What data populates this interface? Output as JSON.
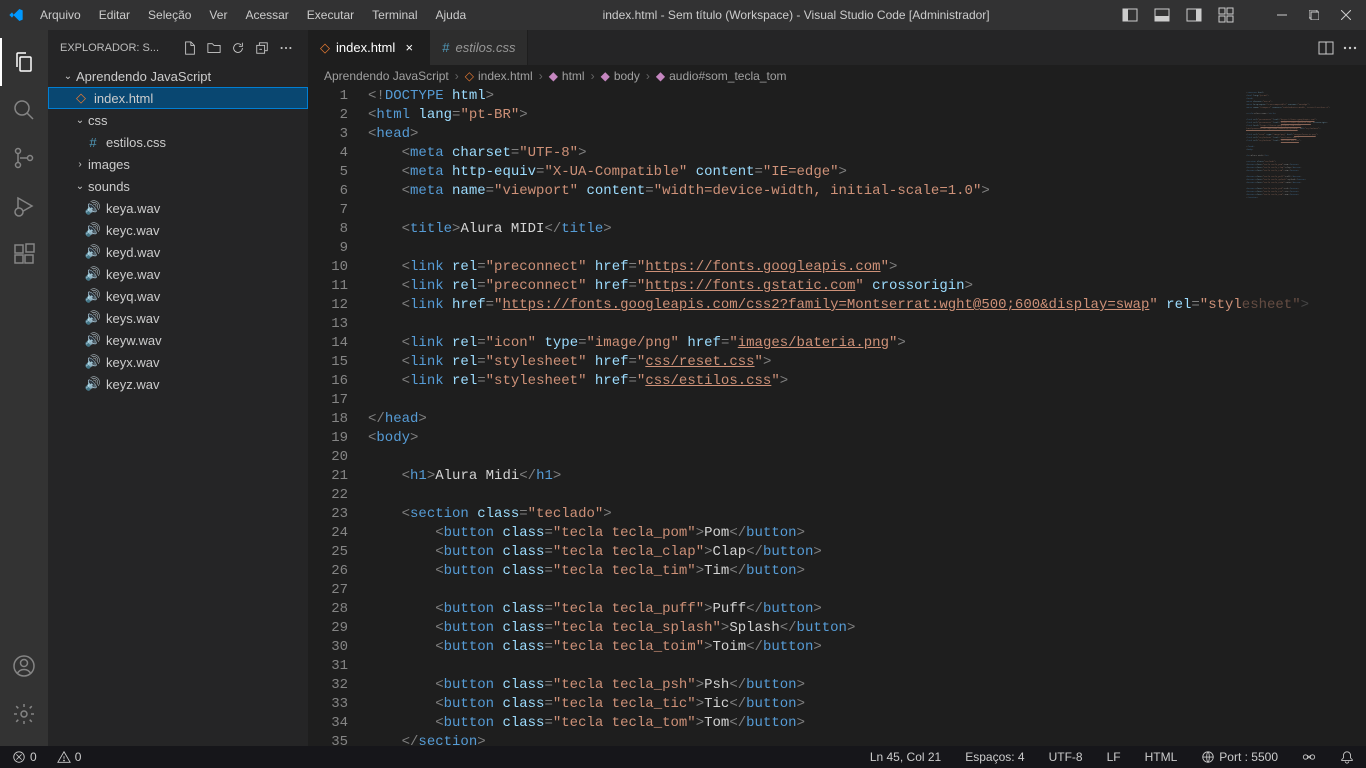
{
  "titlebar": {
    "menus": [
      "Arquivo",
      "Editar",
      "Seleção",
      "Ver",
      "Acessar",
      "Executar",
      "Terminal",
      "Ajuda"
    ],
    "title": "index.html - Sem título (Workspace) - Visual Studio Code [Administrador]"
  },
  "sidebar": {
    "header": "EXPLORADOR: S...",
    "root": "Aprendendo JavaScript",
    "items": [
      {
        "type": "file",
        "name": "index.html",
        "icon": "html",
        "indent": 1,
        "selected": true
      },
      {
        "type": "folder",
        "name": "css",
        "open": true,
        "indent": 1
      },
      {
        "type": "file",
        "name": "estilos.css",
        "icon": "css",
        "indent": 2
      },
      {
        "type": "folder",
        "name": "images",
        "open": false,
        "indent": 1
      },
      {
        "type": "folder",
        "name": "sounds",
        "open": true,
        "indent": 1
      },
      {
        "type": "file",
        "name": "keya.wav",
        "icon": "audio",
        "indent": 2
      },
      {
        "type": "file",
        "name": "keyc.wav",
        "icon": "audio",
        "indent": 2
      },
      {
        "type": "file",
        "name": "keyd.wav",
        "icon": "audio",
        "indent": 2
      },
      {
        "type": "file",
        "name": "keye.wav",
        "icon": "audio",
        "indent": 2
      },
      {
        "type": "file",
        "name": "keyq.wav",
        "icon": "audio",
        "indent": 2
      },
      {
        "type": "file",
        "name": "keys.wav",
        "icon": "audio",
        "indent": 2
      },
      {
        "type": "file",
        "name": "keyw.wav",
        "icon": "audio",
        "indent": 2
      },
      {
        "type": "file",
        "name": "keyx.wav",
        "icon": "audio",
        "indent": 2
      },
      {
        "type": "file",
        "name": "keyz.wav",
        "icon": "audio",
        "indent": 2
      }
    ]
  },
  "tabs": [
    {
      "name": "index.html",
      "icon": "html",
      "active": true
    },
    {
      "name": "estilos.css",
      "icon": "css",
      "active": false
    }
  ],
  "breadcrumbs": [
    "Aprendendo JavaScript",
    "index.html",
    "html",
    "body",
    "audio#som_tecla_tom"
  ],
  "code_lines": [
    [
      [
        "angle",
        "<!"
      ],
      [
        "doctype",
        "DOCTYPE"
      ],
      [
        "text",
        " "
      ],
      [
        "attr",
        "html"
      ],
      [
        "angle",
        ">"
      ]
    ],
    [
      [
        "angle",
        "<"
      ],
      [
        "tag",
        "html"
      ],
      [
        "text",
        " "
      ],
      [
        "attr",
        "lang"
      ],
      [
        "angle",
        "="
      ],
      [
        "str",
        "\"pt-BR\""
      ],
      [
        "angle",
        ">"
      ]
    ],
    [
      [
        "angle",
        "<"
      ],
      [
        "tag",
        "head"
      ],
      [
        "angle",
        ">"
      ]
    ],
    [
      [
        "text",
        "    "
      ],
      [
        "angle",
        "<"
      ],
      [
        "tag",
        "meta"
      ],
      [
        "text",
        " "
      ],
      [
        "attr",
        "charset"
      ],
      [
        "angle",
        "="
      ],
      [
        "str",
        "\"UTF-8\""
      ],
      [
        "angle",
        ">"
      ]
    ],
    [
      [
        "text",
        "    "
      ],
      [
        "angle",
        "<"
      ],
      [
        "tag",
        "meta"
      ],
      [
        "text",
        " "
      ],
      [
        "attr",
        "http-equiv"
      ],
      [
        "angle",
        "="
      ],
      [
        "str",
        "\"X-UA-Compatible\""
      ],
      [
        "text",
        " "
      ],
      [
        "attr",
        "content"
      ],
      [
        "angle",
        "="
      ],
      [
        "str",
        "\"IE=edge\""
      ],
      [
        "angle",
        ">"
      ]
    ],
    [
      [
        "text",
        "    "
      ],
      [
        "angle",
        "<"
      ],
      [
        "tag",
        "meta"
      ],
      [
        "text",
        " "
      ],
      [
        "attr",
        "name"
      ],
      [
        "angle",
        "="
      ],
      [
        "str",
        "\"viewport\""
      ],
      [
        "text",
        " "
      ],
      [
        "attr",
        "content"
      ],
      [
        "angle",
        "="
      ],
      [
        "str",
        "\"width=device-width, initial-scale=1.0\""
      ],
      [
        "angle",
        ">"
      ]
    ],
    [],
    [
      [
        "text",
        "    "
      ],
      [
        "angle",
        "<"
      ],
      [
        "tag",
        "title"
      ],
      [
        "angle",
        ">"
      ],
      [
        "text",
        "Alura MIDI"
      ],
      [
        "angle",
        "</"
      ],
      [
        "tag",
        "title"
      ],
      [
        "angle",
        ">"
      ]
    ],
    [],
    [
      [
        "text",
        "    "
      ],
      [
        "angle",
        "<"
      ],
      [
        "tag",
        "link"
      ],
      [
        "text",
        " "
      ],
      [
        "attr",
        "rel"
      ],
      [
        "angle",
        "="
      ],
      [
        "str",
        "\"preconnect\""
      ],
      [
        "text",
        " "
      ],
      [
        "attr",
        "href"
      ],
      [
        "angle",
        "="
      ],
      [
        "str",
        "\""
      ],
      [
        "link",
        "https://fonts.googleapis.com"
      ],
      [
        "str",
        "\""
      ],
      [
        "angle",
        ">"
      ]
    ],
    [
      [
        "text",
        "    "
      ],
      [
        "angle",
        "<"
      ],
      [
        "tag",
        "link"
      ],
      [
        "text",
        " "
      ],
      [
        "attr",
        "rel"
      ],
      [
        "angle",
        "="
      ],
      [
        "str",
        "\"preconnect\""
      ],
      [
        "text",
        " "
      ],
      [
        "attr",
        "href"
      ],
      [
        "angle",
        "="
      ],
      [
        "str",
        "\""
      ],
      [
        "link",
        "https://fonts.gstatic.com"
      ],
      [
        "str",
        "\""
      ],
      [
        "text",
        " "
      ],
      [
        "attr",
        "crossorigin"
      ],
      [
        "angle",
        ">"
      ]
    ],
    [
      [
        "text",
        "    "
      ],
      [
        "angle",
        "<"
      ],
      [
        "tag",
        "link"
      ],
      [
        "text",
        " "
      ],
      [
        "attr",
        "href"
      ],
      [
        "angle",
        "="
      ],
      [
        "str",
        "\""
      ],
      [
        "link",
        "https://fonts.googleapis.com/css2?family=Montserrat:wght@500;600&display=swap"
      ],
      [
        "str",
        "\""
      ],
      [
        "text",
        " "
      ],
      [
        "attr",
        "rel"
      ],
      [
        "angle",
        "="
      ],
      [
        "str",
        "\"stylesheet\""
      ],
      [
        "angle",
        ">"
      ]
    ],
    [],
    [
      [
        "text",
        "    "
      ],
      [
        "angle",
        "<"
      ],
      [
        "tag",
        "link"
      ],
      [
        "text",
        " "
      ],
      [
        "attr",
        "rel"
      ],
      [
        "angle",
        "="
      ],
      [
        "str",
        "\"icon\""
      ],
      [
        "text",
        " "
      ],
      [
        "attr",
        "type"
      ],
      [
        "angle",
        "="
      ],
      [
        "str",
        "\"image/png\""
      ],
      [
        "text",
        " "
      ],
      [
        "attr",
        "href"
      ],
      [
        "angle",
        "="
      ],
      [
        "str",
        "\""
      ],
      [
        "link",
        "images/bateria.png"
      ],
      [
        "str",
        "\""
      ],
      [
        "angle",
        ">"
      ]
    ],
    [
      [
        "text",
        "    "
      ],
      [
        "angle",
        "<"
      ],
      [
        "tag",
        "link"
      ],
      [
        "text",
        " "
      ],
      [
        "attr",
        "rel"
      ],
      [
        "angle",
        "="
      ],
      [
        "str",
        "\"stylesheet\""
      ],
      [
        "text",
        " "
      ],
      [
        "attr",
        "href"
      ],
      [
        "angle",
        "="
      ],
      [
        "str",
        "\""
      ],
      [
        "link",
        "css/reset.css"
      ],
      [
        "str",
        "\""
      ],
      [
        "angle",
        ">"
      ]
    ],
    [
      [
        "text",
        "    "
      ],
      [
        "angle",
        "<"
      ],
      [
        "tag",
        "link"
      ],
      [
        "text",
        " "
      ],
      [
        "attr",
        "rel"
      ],
      [
        "angle",
        "="
      ],
      [
        "str",
        "\"stylesheet\""
      ],
      [
        "text",
        " "
      ],
      [
        "attr",
        "href"
      ],
      [
        "angle",
        "="
      ],
      [
        "str",
        "\""
      ],
      [
        "link",
        "css/estilos.css"
      ],
      [
        "str",
        "\""
      ],
      [
        "angle",
        ">"
      ]
    ],
    [],
    [
      [
        "angle",
        "</"
      ],
      [
        "tag",
        "head"
      ],
      [
        "angle",
        ">"
      ]
    ],
    [
      [
        "angle",
        "<"
      ],
      [
        "tag",
        "body"
      ],
      [
        "angle",
        ">"
      ]
    ],
    [],
    [
      [
        "text",
        "    "
      ],
      [
        "angle",
        "<"
      ],
      [
        "tag",
        "h1"
      ],
      [
        "angle",
        ">"
      ],
      [
        "text",
        "Alura Midi"
      ],
      [
        "angle",
        "</"
      ],
      [
        "tag",
        "h1"
      ],
      [
        "angle",
        ">"
      ]
    ],
    [],
    [
      [
        "text",
        "    "
      ],
      [
        "angle",
        "<"
      ],
      [
        "tag",
        "section"
      ],
      [
        "text",
        " "
      ],
      [
        "attr",
        "class"
      ],
      [
        "angle",
        "="
      ],
      [
        "str",
        "\"teclado\""
      ],
      [
        "angle",
        ">"
      ]
    ],
    [
      [
        "text",
        "        "
      ],
      [
        "angle",
        "<"
      ],
      [
        "tag",
        "button"
      ],
      [
        "text",
        " "
      ],
      [
        "attr",
        "class"
      ],
      [
        "angle",
        "="
      ],
      [
        "str",
        "\"tecla tecla_pom\""
      ],
      [
        "angle",
        ">"
      ],
      [
        "text",
        "Pom"
      ],
      [
        "angle",
        "</"
      ],
      [
        "tag",
        "button"
      ],
      [
        "angle",
        ">"
      ]
    ],
    [
      [
        "text",
        "        "
      ],
      [
        "angle",
        "<"
      ],
      [
        "tag",
        "button"
      ],
      [
        "text",
        " "
      ],
      [
        "attr",
        "class"
      ],
      [
        "angle",
        "="
      ],
      [
        "str",
        "\"tecla tecla_clap\""
      ],
      [
        "angle",
        ">"
      ],
      [
        "text",
        "Clap"
      ],
      [
        "angle",
        "</"
      ],
      [
        "tag",
        "button"
      ],
      [
        "angle",
        ">"
      ]
    ],
    [
      [
        "text",
        "        "
      ],
      [
        "angle",
        "<"
      ],
      [
        "tag",
        "button"
      ],
      [
        "text",
        " "
      ],
      [
        "attr",
        "class"
      ],
      [
        "angle",
        "="
      ],
      [
        "str",
        "\"tecla tecla_tim\""
      ],
      [
        "angle",
        ">"
      ],
      [
        "text",
        "Tim"
      ],
      [
        "angle",
        "</"
      ],
      [
        "tag",
        "button"
      ],
      [
        "angle",
        ">"
      ]
    ],
    [],
    [
      [
        "text",
        "        "
      ],
      [
        "angle",
        "<"
      ],
      [
        "tag",
        "button"
      ],
      [
        "text",
        " "
      ],
      [
        "attr",
        "class"
      ],
      [
        "angle",
        "="
      ],
      [
        "str",
        "\"tecla tecla_puff\""
      ],
      [
        "angle",
        ">"
      ],
      [
        "text",
        "Puff"
      ],
      [
        "angle",
        "</"
      ],
      [
        "tag",
        "button"
      ],
      [
        "angle",
        ">"
      ]
    ],
    [
      [
        "text",
        "        "
      ],
      [
        "angle",
        "<"
      ],
      [
        "tag",
        "button"
      ],
      [
        "text",
        " "
      ],
      [
        "attr",
        "class"
      ],
      [
        "angle",
        "="
      ],
      [
        "str",
        "\"tecla tecla_splash\""
      ],
      [
        "angle",
        ">"
      ],
      [
        "text",
        "Splash"
      ],
      [
        "angle",
        "</"
      ],
      [
        "tag",
        "button"
      ],
      [
        "angle",
        ">"
      ]
    ],
    [
      [
        "text",
        "        "
      ],
      [
        "angle",
        "<"
      ],
      [
        "tag",
        "button"
      ],
      [
        "text",
        " "
      ],
      [
        "attr",
        "class"
      ],
      [
        "angle",
        "="
      ],
      [
        "str",
        "\"tecla tecla_toim\""
      ],
      [
        "angle",
        ">"
      ],
      [
        "text",
        "Toim"
      ],
      [
        "angle",
        "</"
      ],
      [
        "tag",
        "button"
      ],
      [
        "angle",
        ">"
      ]
    ],
    [],
    [
      [
        "text",
        "        "
      ],
      [
        "angle",
        "<"
      ],
      [
        "tag",
        "button"
      ],
      [
        "text",
        " "
      ],
      [
        "attr",
        "class"
      ],
      [
        "angle",
        "="
      ],
      [
        "str",
        "\"tecla tecla_psh\""
      ],
      [
        "angle",
        ">"
      ],
      [
        "text",
        "Psh"
      ],
      [
        "angle",
        "</"
      ],
      [
        "tag",
        "button"
      ],
      [
        "angle",
        ">"
      ]
    ],
    [
      [
        "text",
        "        "
      ],
      [
        "angle",
        "<"
      ],
      [
        "tag",
        "button"
      ],
      [
        "text",
        " "
      ],
      [
        "attr",
        "class"
      ],
      [
        "angle",
        "="
      ],
      [
        "str",
        "\"tecla tecla_tic\""
      ],
      [
        "angle",
        ">"
      ],
      [
        "text",
        "Tic"
      ],
      [
        "angle",
        "</"
      ],
      [
        "tag",
        "button"
      ],
      [
        "angle",
        ">"
      ]
    ],
    [
      [
        "text",
        "        "
      ],
      [
        "angle",
        "<"
      ],
      [
        "tag",
        "button"
      ],
      [
        "text",
        " "
      ],
      [
        "attr",
        "class"
      ],
      [
        "angle",
        "="
      ],
      [
        "str",
        "\"tecla tecla_tom\""
      ],
      [
        "angle",
        ">"
      ],
      [
        "text",
        "Tom"
      ],
      [
        "angle",
        "</"
      ],
      [
        "tag",
        "button"
      ],
      [
        "angle",
        ">"
      ]
    ],
    [
      [
        "text",
        "    "
      ],
      [
        "angle",
        "</"
      ],
      [
        "tag",
        "section"
      ],
      [
        "angle",
        ">"
      ]
    ]
  ],
  "status": {
    "errors": "0",
    "warnings": "0",
    "ln_col": "Ln 45, Col 21",
    "spaces": "Espaços: 4",
    "encoding": "UTF-8",
    "eol": "LF",
    "lang": "HTML",
    "port": "Port : 5500"
  }
}
